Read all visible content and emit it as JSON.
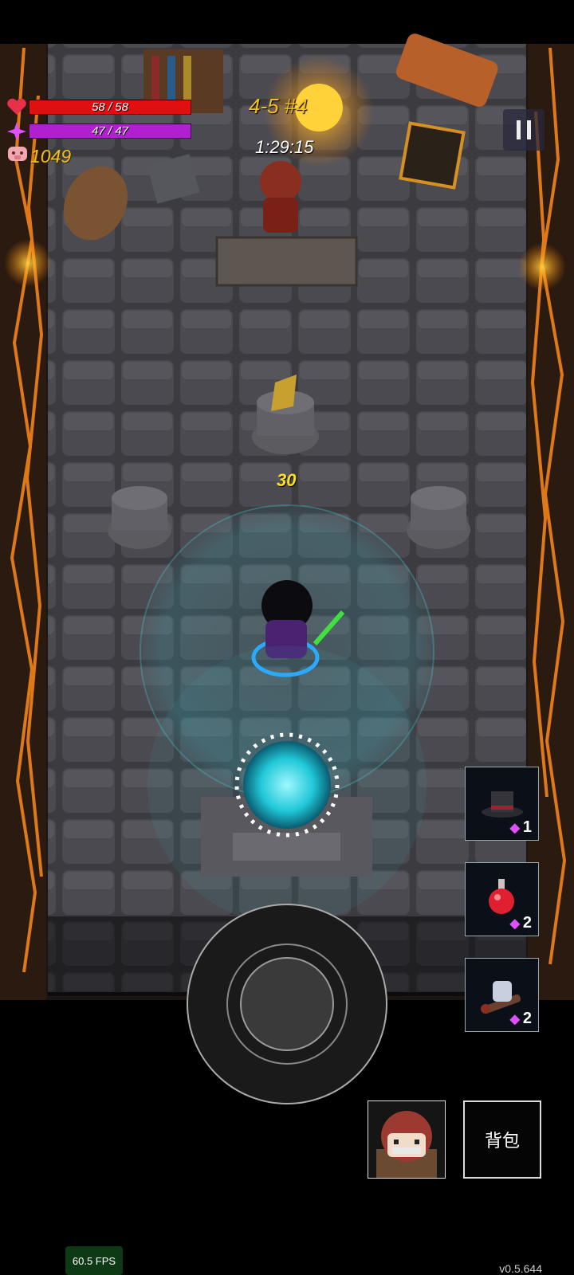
{
  "hud": {
    "hp_text": "58 / 58",
    "mp_text": "47 / 47",
    "gold": "1049",
    "level": "4-5 #4",
    "timer": "1:29:15",
    "damage_popup": "30"
  },
  "player": {
    "hp_fraction": 1.0,
    "mp_fraction": 1.0
  },
  "items": [
    {
      "name": "top-hat-icon",
      "count": "1"
    },
    {
      "name": "red-potion-icon",
      "count": "2"
    },
    {
      "name": "magic-cauldron-icon",
      "count": "2"
    }
  ],
  "controls": {
    "pause_icon": "pause-icon",
    "backpack_label": "背包"
  },
  "debug": {
    "fps": "60.5 FPS",
    "version": "v0.5.644"
  },
  "colors": {
    "hp": "#e01010",
    "mp": "#b020d0",
    "gold": "#f0c020",
    "portal": "#30e0e8",
    "lava": "#ff8a1a"
  }
}
